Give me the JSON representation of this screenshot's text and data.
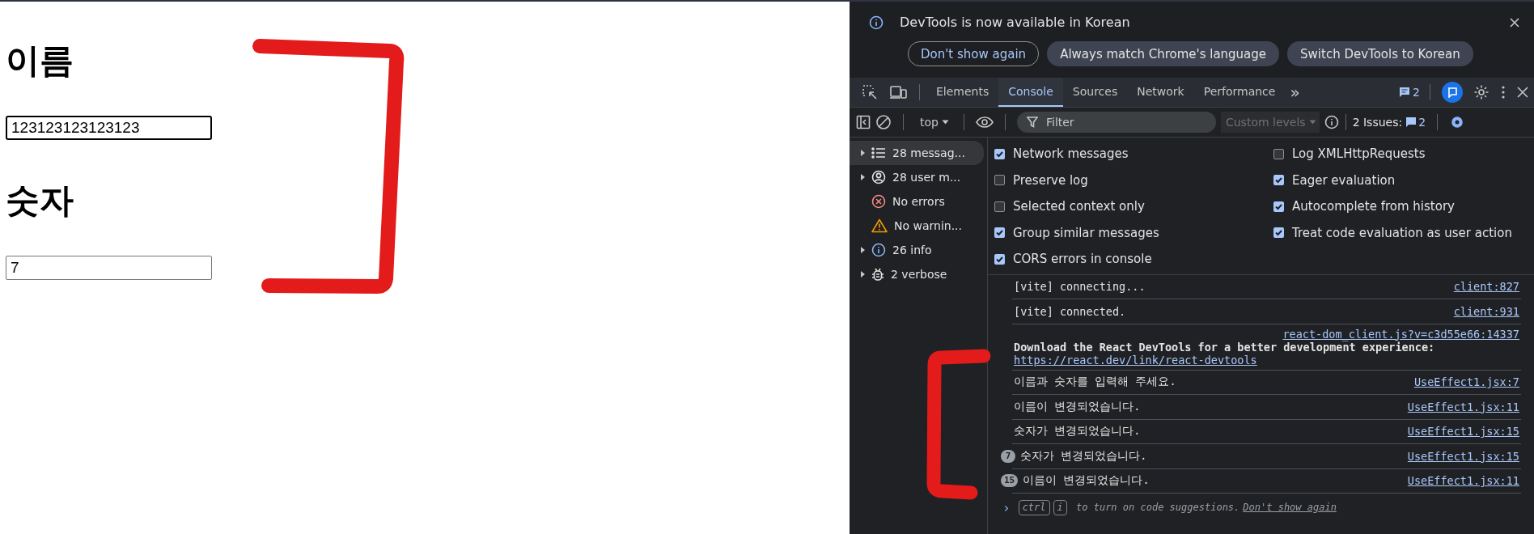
{
  "page": {
    "fields": [
      {
        "heading": "이름",
        "value": "123123123123123",
        "focused": true
      },
      {
        "heading": "숫자",
        "value": "7",
        "focused": false
      }
    ],
    "annotation": {
      "kind": "right-bracket"
    }
  },
  "devtools": {
    "infobar": {
      "message": "DevTools is now available in Korean",
      "buttons": [
        {
          "label": "Don't show again",
          "kind": "outline"
        },
        {
          "label": "Always match Chrome's language",
          "kind": "filled"
        },
        {
          "label": "Switch DevTools to Korean",
          "kind": "filled"
        }
      ]
    },
    "tabs": [
      {
        "label": "Elements",
        "selected": false
      },
      {
        "label": "Console",
        "selected": true
      },
      {
        "label": "Sources",
        "selected": false
      },
      {
        "label": "Network",
        "selected": false
      },
      {
        "label": "Performance",
        "selected": false
      }
    ],
    "tabs_more": "»",
    "issues_badge": "2",
    "console_toolbar": {
      "context": "top",
      "filter_placeholder": "Filter",
      "levels": {
        "label": "Custom levels",
        "disabled": true
      },
      "issues_label": "2 Issues:",
      "issues_count": "2"
    },
    "sidebar": [
      {
        "label": "28 messag...",
        "kind": "messages",
        "expandable": true,
        "selected": true
      },
      {
        "label": "28 user m...",
        "kind": "user",
        "expandable": true,
        "selected": false
      },
      {
        "label": "No errors",
        "kind": "error",
        "expandable": false,
        "selected": false
      },
      {
        "label": "No warnin...",
        "kind": "warning",
        "expandable": false,
        "selected": false
      },
      {
        "label": "26 info",
        "kind": "info",
        "expandable": true,
        "selected": false
      },
      {
        "label": "2 verbose",
        "kind": "verbose",
        "expandable": true,
        "selected": false
      }
    ],
    "settings": [
      [
        {
          "label": "Network messages",
          "checked": true
        },
        {
          "label": "Preserve log",
          "checked": false
        },
        {
          "label": "Selected context only",
          "checked": false
        },
        {
          "label": "Group similar messages",
          "checked": true
        },
        {
          "label": "CORS errors in console",
          "checked": true
        }
      ],
      [
        {
          "label": "Log XMLHttpRequests",
          "checked": false
        },
        {
          "label": "Eager evaluation",
          "checked": true
        },
        {
          "label": "Autocomplete from history",
          "checked": true
        },
        {
          "label": "Treat code evaluation as user action",
          "checked": true
        }
      ]
    ],
    "messages": [
      {
        "kind": "log",
        "text": "[vite] connecting...",
        "source": "client:827"
      },
      {
        "kind": "log",
        "text": "[vite] connected.",
        "source": "client:931"
      },
      {
        "kind": "notice",
        "text": "Download the React DevTools for a better development experience:",
        "link": "https://react.dev/link/react-devtools",
        "source": "react-dom_client.js?v=c3d55e66:14337"
      },
      {
        "kind": "log",
        "text": "이름과 숫자를 입력해 주세요.",
        "source": "UseEffect1.jsx:7"
      },
      {
        "kind": "log",
        "text": "이름이 변경되었습니다.",
        "source": "UseEffect1.jsx:11"
      },
      {
        "kind": "log",
        "text": "숫자가 변경되었습니다.",
        "source": "UseEffect1.jsx:15"
      },
      {
        "kind": "log",
        "count": "7",
        "text": "숫자가 변경되었습니다.",
        "source": "UseEffect1.jsx:15"
      },
      {
        "kind": "log",
        "count": "15",
        "text": "이름이 변경되었습니다.",
        "source": "UseEffect1.jsx:11"
      }
    ],
    "prompt": {
      "prompt_glyph": "›",
      "keys": [
        "ctrl",
        "i"
      ],
      "hint": "to turn on code suggestions.",
      "link": "Don't show again"
    },
    "annotation": {
      "kind": "left-bracket"
    }
  }
}
